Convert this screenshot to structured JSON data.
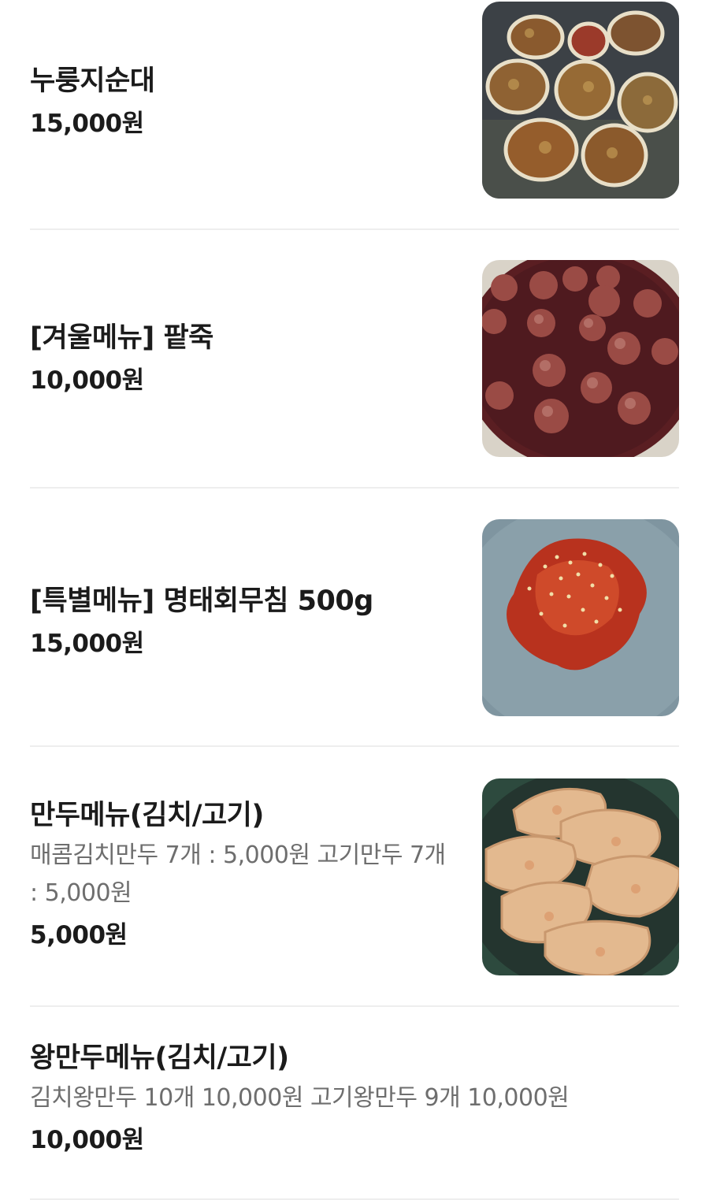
{
  "menu": {
    "items": [
      {
        "name": "누룽지순대",
        "price": "15,000원",
        "image": "grilled-sundae-photo"
      },
      {
        "name": "[겨울메뉴] 팥죽",
        "price": "10,000원",
        "image": "red-bean-porridge-photo"
      },
      {
        "name": "[특별메뉴] 명태회무침 500g",
        "price": "15,000원",
        "image": "pollack-salad-photo"
      },
      {
        "name": "만두메뉴(김치/고기)",
        "description": "매콤김치만두 7개 : 5,000원 고기만두 7개 : 5,000원",
        "price": "5,000원",
        "image": "dumplings-photo"
      },
      {
        "name": "왕만두메뉴(김치/고기)",
        "description": "김치왕만두 10개 10,000원 고기왕만두 9개 10,000원",
        "price": "10,000원"
      }
    ]
  },
  "colors": {
    "text": "#1b1b1b",
    "muted": "#6e6e6e",
    "divider": "#eeeeee"
  }
}
